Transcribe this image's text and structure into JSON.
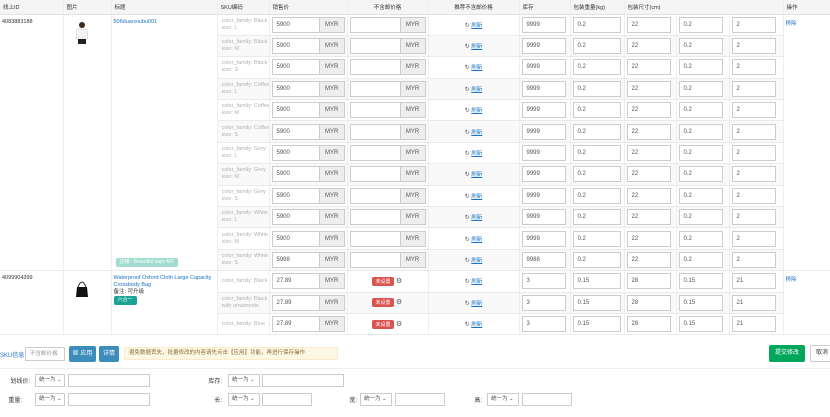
{
  "headers": {
    "online_id": "线上ID",
    "image": "图片",
    "title": "标题",
    "sku_code": "SKU编码",
    "sale_price": "销售价",
    "excl_shipping": "不含邮价格",
    "recommend": "推荐不含邮价格",
    "stock": "库存",
    "weight": "包装重量(kg)",
    "size": "包装尺寸(cm)",
    "actions": "操作"
  },
  "currency": "MYR",
  "refresh_label": "刷新",
  "remove_label": "移除",
  "unset_label": "未设置",
  "products": [
    {
      "id": "4083883188",
      "title": "506duanxiubu001",
      "note_label": "",
      "note_value": "",
      "tag": "",
      "bottom_tag": "店铺 : Beautiful says-MY",
      "image_kind": "shirt",
      "variants": [
        {
          "sku_line1": "color_family: Black",
          "sku_line2": "size: L",
          "price": "5900",
          "excl": "",
          "unset": false,
          "stock": "9999",
          "weight": "0.2",
          "l": "22",
          "w": "0.2",
          "h": "2"
        },
        {
          "sku_line1": "color_family: Black",
          "sku_line2": "size: M",
          "price": "5900",
          "excl": "",
          "unset": false,
          "stock": "9999",
          "weight": "0.2",
          "l": "22",
          "w": "0.2",
          "h": "2"
        },
        {
          "sku_line1": "color_family: Black",
          "sku_line2": "size: S",
          "price": "5900",
          "excl": "",
          "unset": false,
          "stock": "9999",
          "weight": "0.2",
          "l": "22",
          "w": "0.2",
          "h": "2"
        },
        {
          "sku_line1": "color_family: Coffee",
          "sku_line2": "size: L",
          "price": "5900",
          "excl": "",
          "unset": false,
          "stock": "9999",
          "weight": "0.2",
          "l": "22",
          "w": "0.2",
          "h": "2"
        },
        {
          "sku_line1": "color_family: Coffee",
          "sku_line2": "size: M",
          "price": "5900",
          "excl": "",
          "unset": false,
          "stock": "9999",
          "weight": "0.2",
          "l": "22",
          "w": "0.2",
          "h": "2"
        },
        {
          "sku_line1": "color_family: Coffee",
          "sku_line2": "size: S",
          "price": "5900",
          "excl": "",
          "unset": false,
          "stock": "9999",
          "weight": "0.2",
          "l": "22",
          "w": "0.2",
          "h": "2"
        },
        {
          "sku_line1": "color_family: Grey",
          "sku_line2": "size: L",
          "price": "5900",
          "excl": "",
          "unset": false,
          "stock": "9999",
          "weight": "0.2",
          "l": "22",
          "w": "0.2",
          "h": "2"
        },
        {
          "sku_line1": "color_family: Grey",
          "sku_line2": "size: M",
          "price": "5900",
          "excl": "",
          "unset": false,
          "stock": "9999",
          "weight": "0.2",
          "l": "22",
          "w": "0.2",
          "h": "2"
        },
        {
          "sku_line1": "color_family: Grey",
          "sku_line2": "size: S",
          "price": "5900",
          "excl": "",
          "unset": false,
          "stock": "9999",
          "weight": "0.2",
          "l": "22",
          "w": "0.2",
          "h": "2"
        },
        {
          "sku_line1": "color_family: White",
          "sku_line2": "size: L",
          "price": "5900",
          "excl": "",
          "unset": false,
          "stock": "9999",
          "weight": "0.2",
          "l": "22",
          "w": "0.2",
          "h": "2"
        },
        {
          "sku_line1": "color_family: White",
          "sku_line2": "size: M",
          "price": "5900",
          "excl": "",
          "unset": false,
          "stock": "9999",
          "weight": "0.2",
          "l": "22",
          "w": "0.2",
          "h": "2"
        },
        {
          "sku_line1": "color_family: White",
          "sku_line2": "size: S",
          "price": "5988",
          "excl": "",
          "unset": false,
          "stock": "9988",
          "weight": "0.2",
          "l": "22",
          "w": "0.2",
          "h": "2"
        }
      ]
    },
    {
      "id": "4099904399",
      "title": "Waterproof Oxford Cloth Large Capacity Crossbody Bag",
      "note_label": "备注:",
      "note_value": "可升级",
      "tag": "六合一",
      "bottom_tag": "",
      "image_kind": "bag",
      "variants": [
        {
          "sku_line1": "color_family: Black",
          "sku_line2": "",
          "price": "27.89",
          "excl": "",
          "unset": true,
          "stock": "3",
          "weight": "0.15",
          "l": "28",
          "w": "0.15",
          "h": "21"
        },
        {
          "sku_line1": "color_family: Black",
          "sku_line2": "with ornaments",
          "price": "27.89",
          "excl": "",
          "unset": true,
          "stock": "3",
          "weight": "0.15",
          "l": "28",
          "w": "0.15",
          "h": "21"
        },
        {
          "sku_line1": "color_family: Blue",
          "sku_line2": "",
          "price": "27.89",
          "excl": "",
          "unset": true,
          "stock": "3",
          "weight": "0.15",
          "l": "28",
          "w": "0.15",
          "h": "21"
        }
      ]
    }
  ],
  "toolbar": {
    "label": "SKU信息",
    "input_placeholder": "不含邮价格",
    "apply": "应用",
    "detail": "详情",
    "warning": "避免数据丢失，批量修改的内容请先点击【应用】功能，再进行保存操作",
    "submit": "提交修改",
    "cancel": "取消"
  },
  "filters": {
    "price_label": "划线价:",
    "price_select": "统一为",
    "stock_label": "库存:",
    "stock_select": "统一为",
    "weight_label": "重量:",
    "weight_select": "统一为",
    "length_label": "长:",
    "length_select": "统一为",
    "width_label": "宽:",
    "width_select": "统一为",
    "height_label": "高:",
    "height_select": "统一为"
  },
  "colors": {
    "accent_blue": "#3c8dbc",
    "submit_green": "#00a65a",
    "unset_red": "#d9534f",
    "link_blue": "#1a73c8"
  }
}
